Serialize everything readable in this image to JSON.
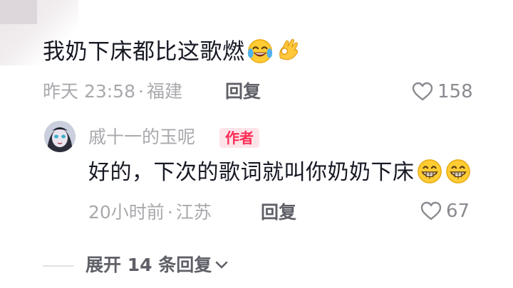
{
  "comment": {
    "text": "我奶下床都比这歌燃",
    "emojis": [
      "laughing-crying-emoji",
      "ok-hand-emoji"
    ],
    "time": "昨天 23:58",
    "separator": "·",
    "location": "福建",
    "reply_label": "回复",
    "like_count": "158"
  },
  "reply": {
    "username": "戚十一的玉呢",
    "badge": "作者",
    "text": "好的，下次的歌词就叫你奶奶下床",
    "emojis": [
      "grinning-emoji",
      "grinning-emoji"
    ],
    "time": "20小时前",
    "separator": "·",
    "location": "江苏",
    "reply_label": "回复",
    "like_count": "67"
  },
  "expand": {
    "label": "展开 14 条回复",
    "icon": "chevron-down-icon"
  },
  "colors": {
    "text_primary": "#161823",
    "text_secondary": "#a8a9ad",
    "author_badge_bg": "#fde4e8",
    "author_badge_text": "#fe2c55"
  }
}
